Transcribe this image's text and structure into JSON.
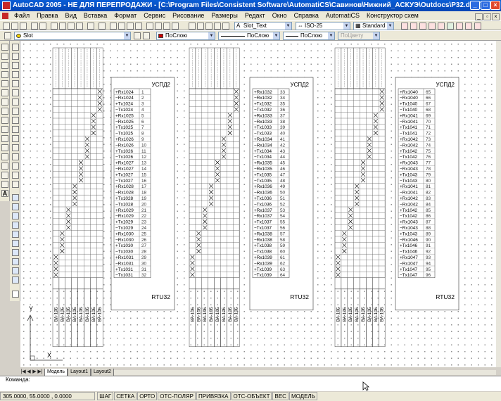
{
  "window": {
    "title": "AutoCAD 2005 - НЕ ДЛЯ ПЕРЕПРОДАЖИ - [C:\\Program Files\\Consistent Software\\AutomatiCS\\Савинов\\Нижний_АСКУЭ\\Outdocs\\P32.dwg]"
  },
  "menu": [
    "Файл",
    "Правка",
    "Вид",
    "Вставка",
    "Формат",
    "Сервис",
    "Рисование",
    "Размеры",
    "Редакт",
    "Окно",
    "Справка",
    "AutomatiCS",
    "Конструктор схем"
  ],
  "toolbar1": {
    "text_style": "Slot_Text",
    "dim_style": "ISO-25",
    "table_style": "Standard"
  },
  "toolbar2": {
    "layer": "Slot",
    "color": "ПоСлою",
    "linetype": "ПоСлою",
    "lineweight": "ПоСлою",
    "plotstyle": "ПоЦвету"
  },
  "drawing": {
    "panels": [
      {
        "title": "УСПД2",
        "footer": "RTU32",
        "rows": [
          {
            "label": "+Rx1024",
            "n": "1"
          },
          {
            "label": "−Rx1024",
            "n": "2"
          },
          {
            "label": "+Tx1024",
            "n": "3"
          },
          {
            "label": "−Tx1024",
            "n": "4"
          },
          {
            "label": "+Rx1025",
            "n": "5"
          },
          {
            "label": "−Rx1025",
            "n": "6"
          },
          {
            "label": "+Tx1025",
            "n": "7"
          },
          {
            "label": "−Tx1025",
            "n": "8"
          },
          {
            "label": "+Rx1026",
            "n": "9"
          },
          {
            "label": "−Rx1026",
            "n": "10"
          },
          {
            "label": "+Tx1026",
            "n": "11"
          },
          {
            "label": "−Tx1026",
            "n": "12"
          },
          {
            "label": "+Rx1027",
            "n": "13"
          },
          {
            "label": "−Rx1027",
            "n": "14"
          },
          {
            "label": "+Tx1027",
            "n": "15"
          },
          {
            "label": "−Tx1027",
            "n": "16"
          },
          {
            "label": "+Rx1028",
            "n": "17"
          },
          {
            "label": "−Rx1028",
            "n": "18"
          },
          {
            "label": "+Tx1028",
            "n": "19"
          },
          {
            "label": "−Tx1028",
            "n": "20"
          },
          {
            "label": "+Rx1029",
            "n": "21"
          },
          {
            "label": "−Rx1029",
            "n": "22"
          },
          {
            "label": "+Tx1029",
            "n": "23"
          },
          {
            "label": "−Tx1029",
            "n": "24"
          },
          {
            "label": "+Rx1030",
            "n": "25"
          },
          {
            "label": "−Rx1030",
            "n": "26"
          },
          {
            "label": "+Tx1030",
            "n": "27"
          },
          {
            "label": "−Tx1030",
            "n": "28"
          },
          {
            "label": "+Rx1031",
            "n": "29"
          },
          {
            "label": "−Rx1031",
            "n": "30"
          },
          {
            "label": "+Tx1031",
            "n": "31"
          },
          {
            "label": "−Tx1031",
            "n": "32"
          }
        ]
      },
      {
        "title": "УСПД2",
        "footer": "RTU32",
        "rows": [
          {
            "label": "+Rx1032",
            "n": "33"
          },
          {
            "label": "−Rx1032",
            "n": "34"
          },
          {
            "label": "+Tx1032",
            "n": "35"
          },
          {
            "label": "−Tx1032",
            "n": "36"
          },
          {
            "label": "+Rx1033",
            "n": "37"
          },
          {
            "label": "−Rx1033",
            "n": "38"
          },
          {
            "label": "+Tx1033",
            "n": "39"
          },
          {
            "label": "−Tx1033",
            "n": "40"
          },
          {
            "label": "+Rx1034",
            "n": "41"
          },
          {
            "label": "−Rx1034",
            "n": "42"
          },
          {
            "label": "+Tx1034",
            "n": "43"
          },
          {
            "label": "−Tx1034",
            "n": "44"
          },
          {
            "label": "+Rx1035",
            "n": "45"
          },
          {
            "label": "−Rx1035",
            "n": "46"
          },
          {
            "label": "+Tx1035",
            "n": "47"
          },
          {
            "label": "−Tx1035",
            "n": "48"
          },
          {
            "label": "+Rx1036",
            "n": "49"
          },
          {
            "label": "−Rx1036",
            "n": "50"
          },
          {
            "label": "+Tx1036",
            "n": "51"
          },
          {
            "label": "−Tx1036",
            "n": "52"
          },
          {
            "label": "+Rx1037",
            "n": "53"
          },
          {
            "label": "−Rx1037",
            "n": "54"
          },
          {
            "label": "+Tx1037",
            "n": "55"
          },
          {
            "label": "−Tx1037",
            "n": "56"
          },
          {
            "label": "+Rx1038",
            "n": "57"
          },
          {
            "label": "−Rx1038",
            "n": "58"
          },
          {
            "label": "+Tx1038",
            "n": "59"
          },
          {
            "label": "−Tx1038",
            "n": "60"
          },
          {
            "label": "+Rx1039",
            "n": "61"
          },
          {
            "label": "−Rx1039",
            "n": "62"
          },
          {
            "label": "+Tx1039",
            "n": "63"
          },
          {
            "label": "−Tx1039",
            "n": "64"
          }
        ]
      },
      {
        "title": "УСПД2",
        "footer": "RTU32",
        "rows": [
          {
            "label": "+Rx1040",
            "n": "65"
          },
          {
            "label": "−Rx1040",
            "n": "66"
          },
          {
            "label": "+Tx1040",
            "n": "67"
          },
          {
            "label": "−Tx1040",
            "n": "68"
          },
          {
            "label": "+Rx1041",
            "n": "69"
          },
          {
            "label": "−Rx1041",
            "n": "70"
          },
          {
            "label": "+Tx1041",
            "n": "71"
          },
          {
            "label": "−Tx1041",
            "n": "72"
          },
          {
            "label": "+Rx1042",
            "n": "73"
          },
          {
            "label": "−Rx1042",
            "n": "74"
          },
          {
            "label": "+Tx1042",
            "n": "75"
          },
          {
            "label": "−Tx1042",
            "n": "76"
          },
          {
            "label": "+Rx1043",
            "n": "77"
          },
          {
            "label": "−Rx1043",
            "n": "78"
          },
          {
            "label": "+Tx1043",
            "n": "79"
          },
          {
            "label": "−Tx1043",
            "n": "80"
          },
          {
            "label": "+Rx1041",
            "n": "81"
          },
          {
            "label": "−Rx1041",
            "n": "82"
          },
          {
            "label": "+Rx1042",
            "n": "83"
          },
          {
            "label": "−Rx1042",
            "n": "84"
          },
          {
            "label": "+Tx1042",
            "n": "85"
          },
          {
            "label": "−Tx1042",
            "n": "86"
          },
          {
            "label": "+Rx1043",
            "n": "87"
          },
          {
            "label": "−Rx1043",
            "n": "88"
          },
          {
            "label": "+Tx1043",
            "n": "89"
          },
          {
            "label": "−Rx1046",
            "n": "90"
          },
          {
            "label": "+Tx1046",
            "n": "91"
          },
          {
            "label": "−Tx1046",
            "n": "92"
          },
          {
            "label": "+Rx1047",
            "n": "93"
          },
          {
            "label": "−Rx1047",
            "n": "94"
          },
          {
            "label": "+Tx1047",
            "n": "95"
          },
          {
            "label": "−Tx1047",
            "n": "96"
          }
        ]
      }
    ],
    "cable_label": "ВА-10Б",
    "ucs_y": "Y",
    "ucs_x": "X"
  },
  "layout_tabs": [
    "Модель",
    "Layout1",
    "Layout2"
  ],
  "command": {
    "prompt": "Команда:"
  },
  "status": {
    "coords": "305.0000, 55.0000 , 0.0000",
    "buttons": [
      "ШАГ",
      "СЕТКА",
      "ОРТО",
      "ОТС-ПОЛЯР",
      "ПРИВЯЗКА",
      "ОТС-ОБЪЕКТ",
      "ВЕС",
      "МОДЕЛЬ"
    ]
  }
}
